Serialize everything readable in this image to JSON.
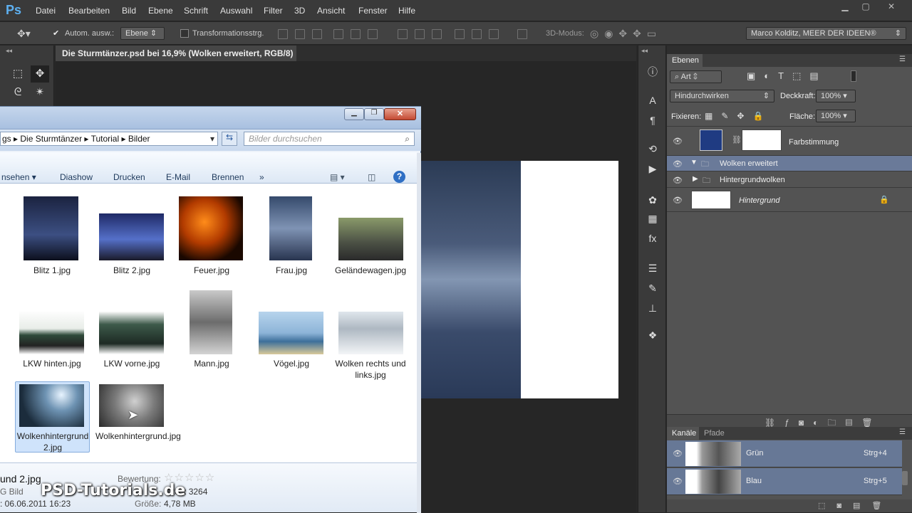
{
  "app": {
    "logo": "Ps",
    "menu": [
      "Datei",
      "Bearbeiten",
      "Bild",
      "Ebene",
      "Schrift",
      "Auswahl",
      "Filter",
      "3D",
      "Ansicht",
      "Fenster",
      "Hilfe"
    ]
  },
  "options": {
    "auto_select_label": "Autom. ausw.:",
    "auto_select_value": "Ebene",
    "transform_label": "Transformationsstrg.",
    "mode_3d": "3D-Modus:",
    "workspace": "Marco Kolditz, MEER DER IDEEN®"
  },
  "document": {
    "tab_title": "Die Sturmtänzer.psd bei 16,9% (Wolken erweitert, RGB/8) *"
  },
  "explorer": {
    "breadcrumb": [
      "gs",
      "Die Sturmtänzer",
      "Tutorial",
      "Bilder"
    ],
    "search_placeholder": "Bilder durchsuchen",
    "commands": [
      "nsehen",
      "Diashow",
      "Drucken",
      "E-Mail",
      "Brennen",
      "»"
    ],
    "files": [
      "Blitz 1.jpg",
      "Blitz 2.jpg",
      "Feuer.jpg",
      "Frau.jpg",
      "Geländewagen.jpg",
      "LKW hinten.jpg",
      "LKW vorne.jpg",
      "Mann.jpg",
      "Vögel.jpg",
      "Wolken rechts und links.jpg",
      "Wolkenhintergrund 2.jpg",
      "Wolkenhintergrund.jpg"
    ],
    "details": {
      "name": "und 2.jpg",
      "type": "G Bild",
      "date": ": 06.06.2011 16:23",
      "rating_label": "Bewertung:",
      "dims": "928 x 3264",
      "size_label": "Größe:",
      "size": "4,78 MB"
    }
  },
  "layers": {
    "panel_title": "Ebenen",
    "filter": "Art",
    "blend_mode": "Hindurchwirken",
    "opacity_label": "Deckkraft:",
    "opacity": "100%",
    "lock_label": "Fixieren:",
    "fill_label": "Fläche:",
    "fill": "100%",
    "items": [
      "Farbstimmung",
      "Wolken erweitert",
      "Hintergrundwolken",
      "Hintergrund"
    ]
  },
  "channels": {
    "tabs": [
      "Kanäle",
      "Pfade"
    ],
    "items": [
      {
        "name": "Grün",
        "shortcut": "Strg+4"
      },
      {
        "name": "Blau",
        "shortcut": "Strg+5"
      }
    ]
  },
  "watermark": "PSD-Tutorials.de"
}
